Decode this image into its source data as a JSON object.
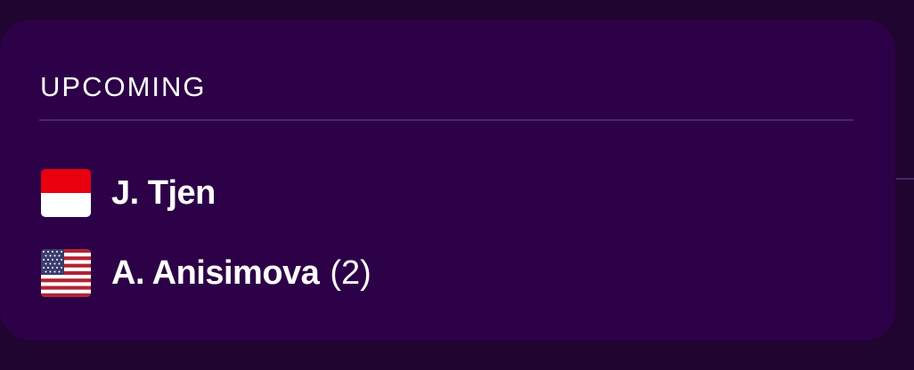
{
  "card": {
    "title": "UPCOMING"
  },
  "players": [
    {
      "name": "J. Tjen",
      "seed": "",
      "flag_icon": "indonesia-flag-icon"
    },
    {
      "name": "A. Anisimova",
      "seed": "(2)",
      "flag_icon": "usa-flag-icon"
    }
  ],
  "colors": {
    "page_background": "#1f0530",
    "card_background": "#2d0147",
    "divider": "#4a2763",
    "text": "#ffffff"
  }
}
